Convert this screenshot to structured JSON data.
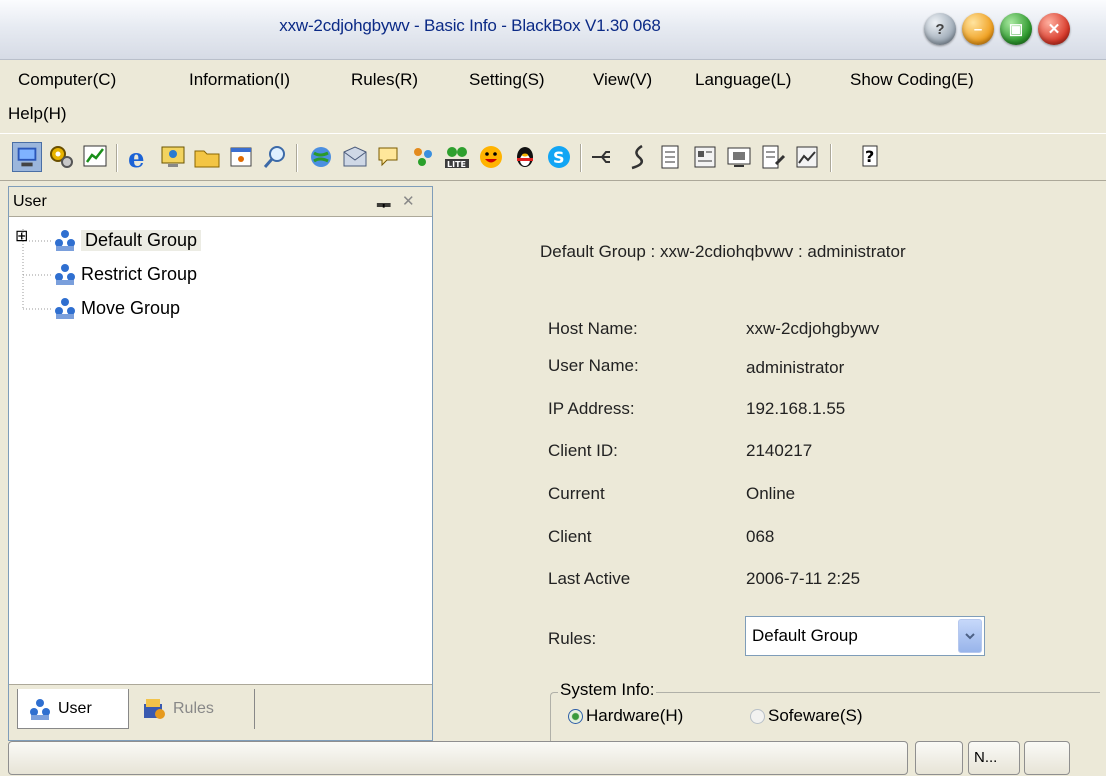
{
  "window": {
    "title": "xxw-2cdjohgbywv - Basic Info - BlackBox V1.30 068",
    "buttons": [
      {
        "name": "help",
        "glyph": "?"
      },
      {
        "name": "minimize",
        "glyph": "–"
      },
      {
        "name": "maximize",
        "glyph": "▣"
      },
      {
        "name": "close",
        "glyph": "✕"
      }
    ]
  },
  "menu": {
    "computer": "Computer(C)",
    "information": "Information(I)",
    "rules": "Rules(R)",
    "setting": "Setting(S)",
    "view": "View(V)",
    "language": "Language(L)",
    "show_coding": "Show Coding(E)",
    "help": "Help(H)"
  },
  "left_pane": {
    "header": "User",
    "pin_glyph": "ᆍ",
    "close_glyph": "✕",
    "expand_glyph": "⊞",
    "tree": [
      "Default Group",
      "Restrict Group",
      "Move Group"
    ],
    "tabs": [
      "User",
      "Rules"
    ]
  },
  "details": {
    "heading": "Default Group : xxw-2cdiohqbvwv : administrator",
    "labels": {
      "host": "Host Name:",
      "user": "User Name:",
      "ip": "IP Address:",
      "client_id": "Client ID:",
      "current": "Current",
      "client": "Client",
      "last_active": "Last Active",
      "rules": "Rules:"
    },
    "values": {
      "host": "xxw-2cdjohgbywv",
      "user": "administrator",
      "ip": "192.168.1.55",
      "client_id": "2140217",
      "current": "Online",
      "client": "068",
      "last_active": "2006-7-11 2:25"
    },
    "rules_select": "Default Group",
    "system_info": {
      "legend": "System Info:",
      "hardware": "Hardware(H)",
      "software": "Sofeware(S)",
      "selected": "hardware"
    }
  },
  "statusbar": {
    "panel": "N..."
  },
  "colors": {
    "title_text": "#0b2a86",
    "help_btn": "#9aa7b4",
    "minimize_btn": "#f0a020",
    "maximize_btn": "#2e9a2e",
    "close_btn": "#d83a2a",
    "select_border": "#7f9db9"
  }
}
